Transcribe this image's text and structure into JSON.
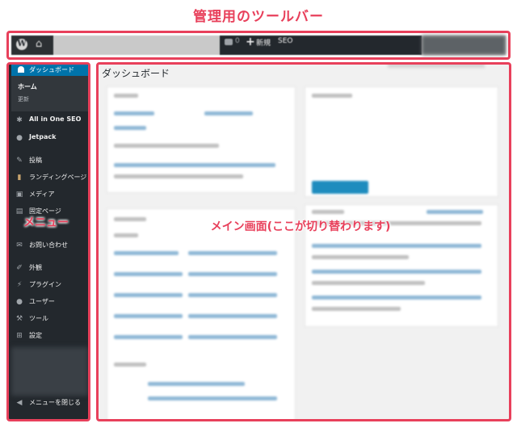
{
  "annotations": {
    "toolbar_label": "管理用のツールバー",
    "menu_label": "メニュー",
    "main_label": "メイン画面(ここが切り替わります)"
  },
  "toolbar": {
    "comment_count": "0",
    "new_label": "新規",
    "seo_label": "SEO"
  },
  "sidebar": {
    "dashboard_label": "ダッシュボード",
    "sub_home": "ホーム",
    "sub_update": "更新",
    "items": [
      {
        "label": "All in One SEO",
        "icon": "gear-icon"
      },
      {
        "label": "Jetpack",
        "icon": "jetpack-icon"
      },
      {
        "label": "投稿",
        "icon": "pin-icon"
      },
      {
        "label": "ランディングページ",
        "icon": "landing-icon"
      },
      {
        "label": "メディア",
        "icon": "media-icon"
      },
      {
        "label": "固定ページ",
        "icon": "page-icon"
      },
      {
        "label": "お問い合わせ",
        "icon": "mail-icon"
      },
      {
        "label": "外観",
        "icon": "brush-icon"
      },
      {
        "label": "プラグイン",
        "icon": "plugin-icon"
      },
      {
        "label": "ユーザー",
        "icon": "user-icon"
      },
      {
        "label": "ツール",
        "icon": "wrench-icon"
      },
      {
        "label": "設定",
        "icon": "settings-icon"
      }
    ],
    "collapse_label": "メニューを閉じる"
  },
  "main": {
    "title": "ダッシュボード"
  },
  "colors": {
    "annotation": "#e8405b",
    "admin_bar": "#23282d",
    "accent": "#0073aa"
  }
}
